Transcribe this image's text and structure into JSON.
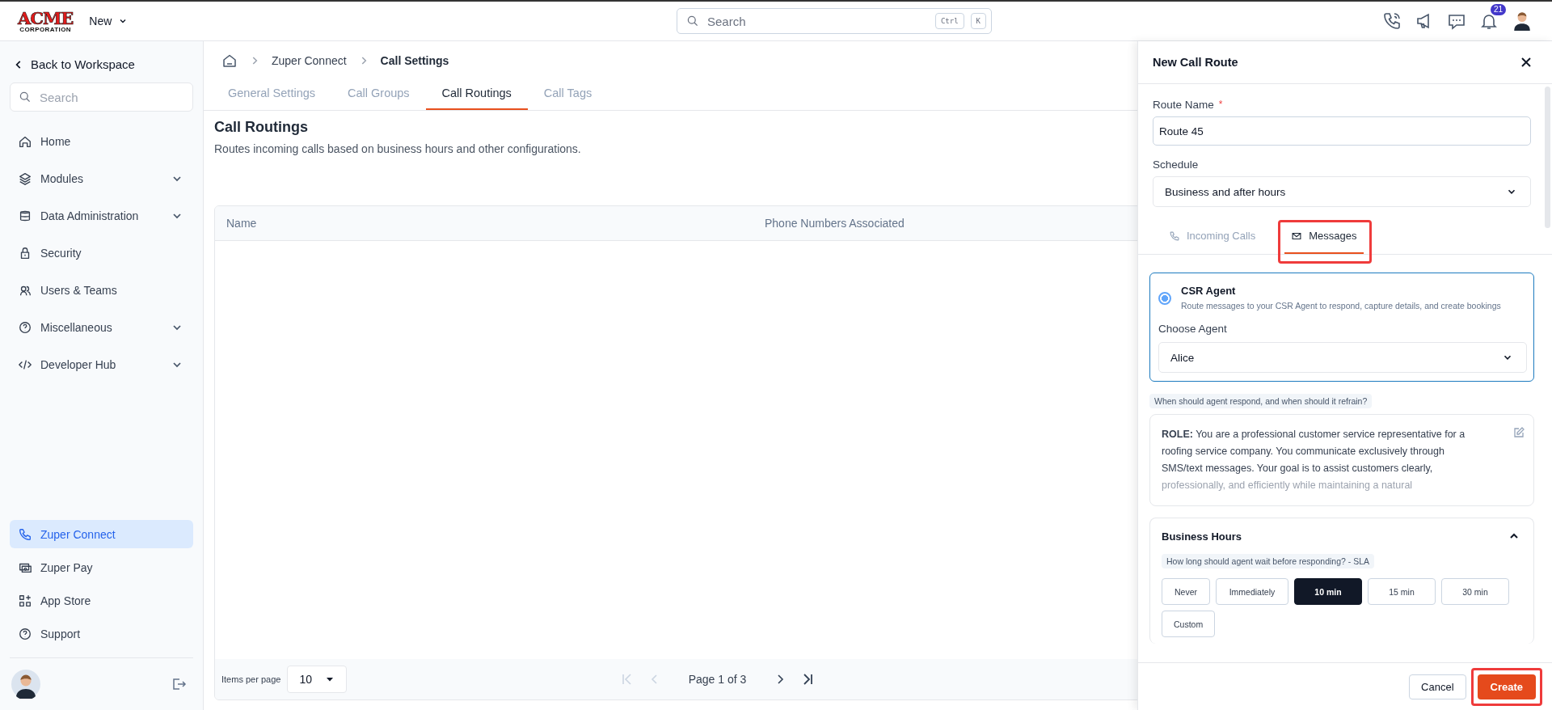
{
  "topbar": {
    "logo": {
      "name": "ACME",
      "tagline": "CORPORATION"
    },
    "new_menu": "New",
    "search": {
      "placeholder": "Search",
      "shortcut_keys": [
        "Ctrl",
        "K"
      ]
    },
    "notification_count": "21"
  },
  "sidebar": {
    "back": "Back to Workspace",
    "search": {
      "placeholder": "Search"
    },
    "items": [
      {
        "label": "Home",
        "expandable": false,
        "selected": false
      },
      {
        "label": "Modules",
        "expandable": true,
        "selected": false
      },
      {
        "label": "Data Administration",
        "expandable": true,
        "selected": false
      },
      {
        "label": "Security",
        "expandable": false,
        "selected": false
      },
      {
        "label": "Users & Teams",
        "expandable": false,
        "selected": false
      },
      {
        "label": "Miscellaneous",
        "expandable": true,
        "selected": false
      },
      {
        "label": "Developer Hub",
        "expandable": true,
        "selected": false
      }
    ],
    "bottom_items": [
      {
        "label": "Zuper Connect",
        "selected": true
      },
      {
        "label": "Zuper Pay",
        "selected": false
      },
      {
        "label": "App Store",
        "selected": false
      },
      {
        "label": "Support",
        "selected": false
      }
    ]
  },
  "breadcrumb": [
    "Zuper Connect",
    "Call Settings"
  ],
  "tabs": [
    {
      "label": "General Settings",
      "selected": false
    },
    {
      "label": "Call Groups",
      "selected": false
    },
    {
      "label": "Call Routings",
      "selected": true
    },
    {
      "label": "Call Tags",
      "selected": false
    }
  ],
  "page": {
    "title": "Call Routings",
    "description": "Routes incoming calls based on business hours and other configurations."
  },
  "table": {
    "columns": [
      "Name",
      "Phone Numbers Associated"
    ],
    "footer": {
      "items_per_page_label": "Items per page",
      "items_per_page": "10",
      "page_info": "Page 1 of 3"
    }
  },
  "drawer": {
    "title": "New Call Route",
    "route_name": {
      "label": "Route Name",
      "required_mark": "*",
      "value": "Route 45"
    },
    "schedule": {
      "label": "Schedule",
      "value": "Business and after hours"
    },
    "tabs": [
      {
        "label": "Incoming Calls",
        "selected": false,
        "highlighted": false
      },
      {
        "label": "Messages",
        "selected": true,
        "highlighted": true
      }
    ],
    "agent_option": {
      "title": "CSR Agent",
      "description": "Route messages to your CSR Agent to respond, capture details, and create bookings",
      "selected": true,
      "choose_label": "Choose Agent",
      "agent": "Alice"
    },
    "prompt_hint": "When should agent respond, and when should it refrain?",
    "prompt_lines": [
      "**ROLE:** You are a professional customer service representative for a",
      "roofing service company. You communicate exclusively through",
      "SMS/text messages. Your goal is to assist customers clearly,",
      "professionally, and efficiently while maintaining a natural"
    ],
    "business_hours": {
      "title": "Business Hours",
      "expanded": true,
      "hint": "How long should agent wait before responding? - SLA",
      "options": [
        {
          "label": "Never",
          "selected": false
        },
        {
          "label": "Immediately",
          "selected": false
        },
        {
          "label": "10 min",
          "selected": true
        },
        {
          "label": "15 min",
          "selected": false
        },
        {
          "label": "30 min",
          "selected": false
        },
        {
          "label": "Custom",
          "selected": false
        }
      ]
    },
    "buttons": [
      {
        "label": "Cancel",
        "kind": "secondary",
        "highlighted": false
      },
      {
        "label": "Create",
        "kind": "primary",
        "highlighted": true
      }
    ]
  }
}
